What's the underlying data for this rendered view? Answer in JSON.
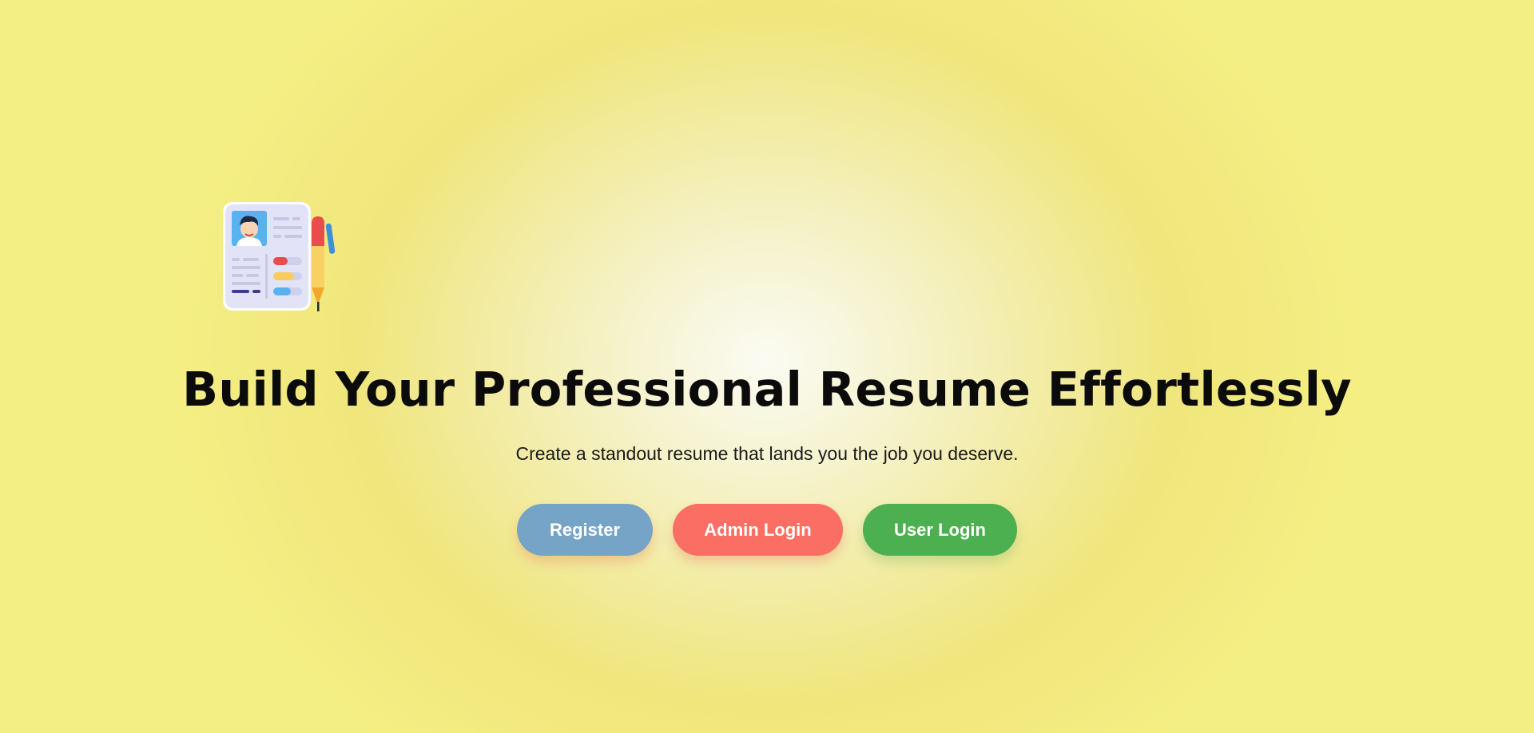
{
  "hero": {
    "illustration_icon": "resume-document-with-pen-icon",
    "title": "Build Your Professional Resume Effortlessly",
    "subtitle": "Create a standout resume that lands you the job you deserve."
  },
  "actions": {
    "register_label": "Register",
    "admin_login_label": "Admin Login",
    "user_login_label": "User Login"
  },
  "colors": {
    "background_center": "#fbfbf3",
    "background_edge": "#f4ef84",
    "register": "#76a4c6",
    "admin_login": "#fb6e63",
    "user_login": "#4caf50",
    "title_text": "#0b0b0b"
  }
}
